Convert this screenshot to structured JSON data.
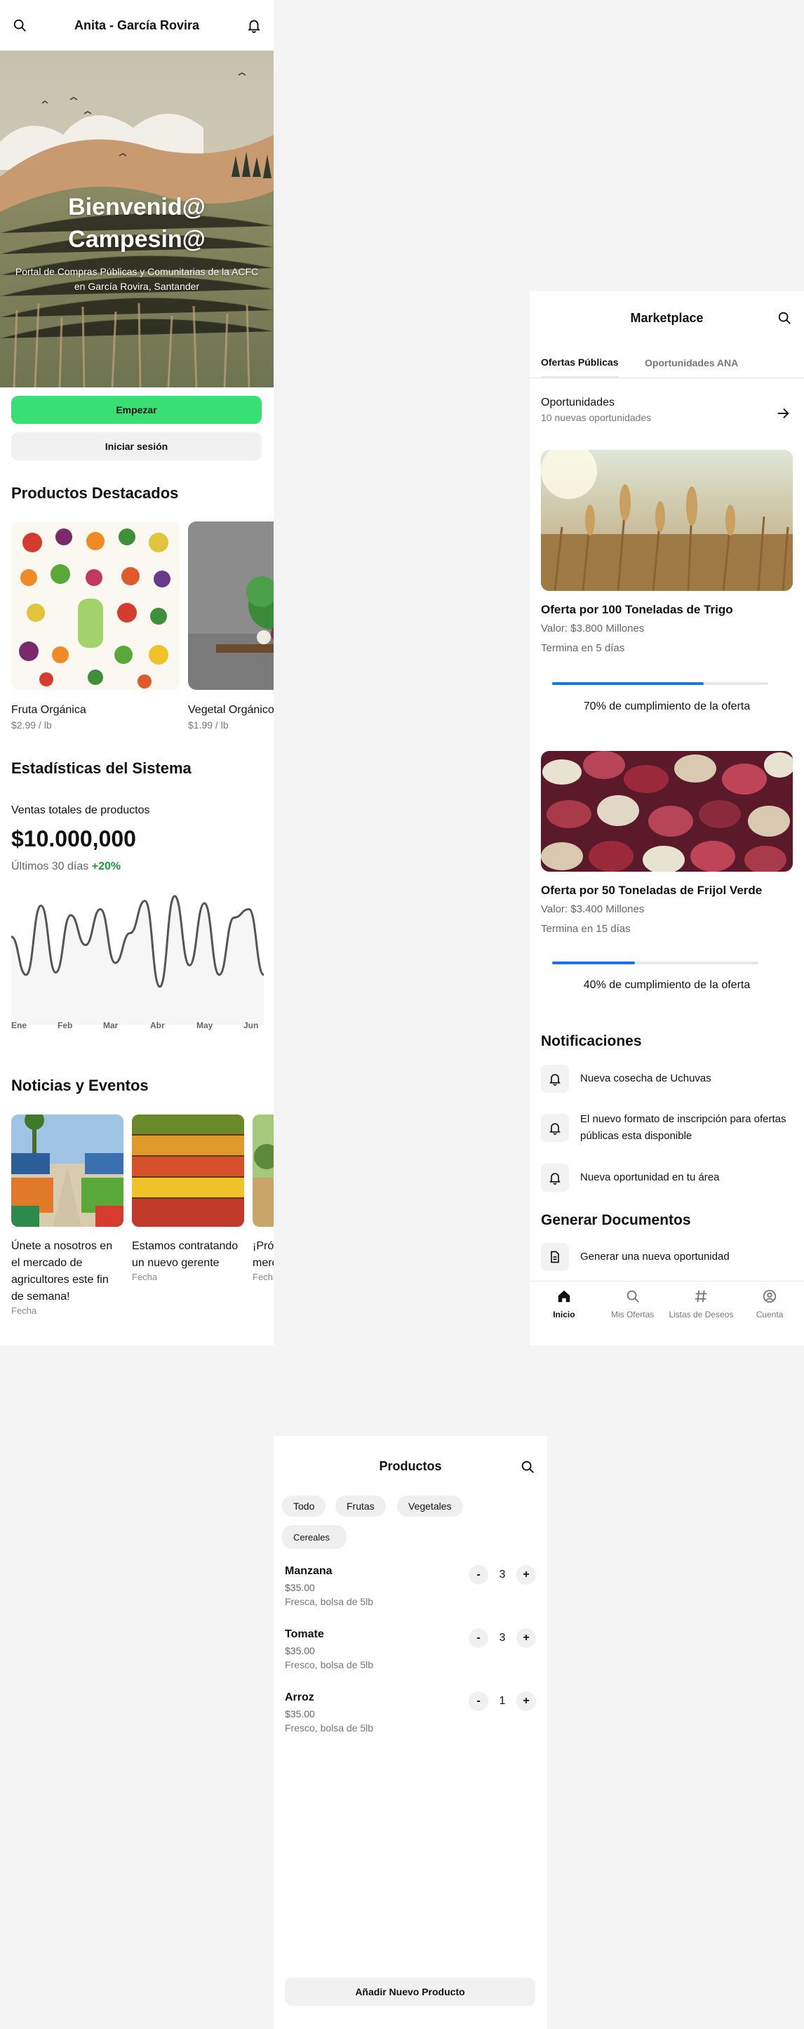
{
  "home": {
    "title": "Anita - García Rovira",
    "hero_title_line1": "Bienvenid@",
    "hero_title_line2": "Campesin@",
    "hero_subtitle": "Portal de Compras Públicas y Comunitarias de la ACFC en García Rovira, Santander",
    "start_label": "Empezar",
    "login_label": "Iniciar sesión",
    "featured_title": "Productos Destacados",
    "products": [
      {
        "name": "Fruta Orgánica",
        "price": "$2.99 / lb"
      },
      {
        "name": "Vegetal Orgánico",
        "price": "$1.99 / lb"
      }
    ],
    "stats_title": "Estadísticas del Sistema",
    "stats": {
      "label": "Ventas totales de productos",
      "value": "$10.000,000",
      "period": "Últimos 30 días",
      "change": "+20%"
    },
    "months": [
      "Ene",
      "Feb",
      "Mar",
      "Abr",
      "May",
      "Jun"
    ],
    "news_title": "Noticias y Eventos",
    "news": [
      {
        "title": "Únete a nosotros en el mercado de agricultores este fin de semana!",
        "date": "Fecha"
      },
      {
        "title": "Estamos contratando un nuevo gerente",
        "date": "Fecha"
      },
      {
        "title": "¡Próximo evento de mercado",
        "date": "Fecha"
      }
    ]
  },
  "chart_data": {
    "type": "line",
    "categories": [
      "Ene",
      "Feb",
      "Mar",
      "Abr",
      "May",
      "Jun"
    ],
    "series": [
      {
        "values": [
          62,
          30,
          88,
          32,
          80,
          55,
          85,
          40,
          65,
          92,
          20,
          96,
          38,
          90,
          30,
          78,
          85,
          30
        ]
      }
    ],
    "title": "",
    "xlabel": "",
    "ylabel": ""
  },
  "marketplace": {
    "title": "Marketplace",
    "tabs": [
      "Ofertas Públicas",
      "Oportunidades ANA"
    ],
    "opportunities_title": "Oportunidades",
    "opportunities_sub": "10 nuevas oportunidades",
    "offers": [
      {
        "title": "Oferta por 100 Toneladas de Trigo",
        "value": "Valor: $3.800 Millones",
        "ends": "Termina en 5 días",
        "progress": 0.7,
        "progress_text": "70% de cumplimiento de la oferta"
      },
      {
        "title": "Oferta por 50 Toneladas de Frijol Verde",
        "value": "Valor: $3.400 Millones",
        "ends": "Termina en 15 días",
        "progress": 0.4,
        "progress_text": "40% de cumplimiento de la oferta"
      }
    ],
    "notifications_title": "Notificaciones",
    "notifications": [
      "Nueva cosecha de Uchuvas",
      "El nuevo formato de inscripción para ofertas públicas esta disponible",
      "Nueva oportunidad en tu área"
    ],
    "documents_title": "Generar Documentos",
    "documents": [
      "Generar una nueva oportunidad"
    ],
    "nav": [
      "Inicio",
      "Mis Ofertas",
      "Listas de Deseos",
      "Cuenta"
    ]
  },
  "products_page": {
    "title": "Productos",
    "chips": [
      "Todo",
      "Frutas",
      "Vegetales",
      "Cereales"
    ],
    "items": [
      {
        "name": "Manzana",
        "price": "$35.00",
        "desc": "Fresca, bolsa de 5lb",
        "qty": "3"
      },
      {
        "name": "Tomate",
        "price": "$35.00",
        "desc": "Fresco, bolsa de 5lb",
        "qty": "3"
      },
      {
        "name": "Arroz",
        "price": "$35.00",
        "desc": "Fresco, bolsa de 5lb",
        "qty": "1"
      }
    ],
    "minus": "-",
    "plus": "+",
    "add_label": "Añadir Nuevo Producto"
  },
  "colors": {
    "accent": "#38df73",
    "progress": "#1a73e8",
    "positive": "#1a9f3c"
  }
}
